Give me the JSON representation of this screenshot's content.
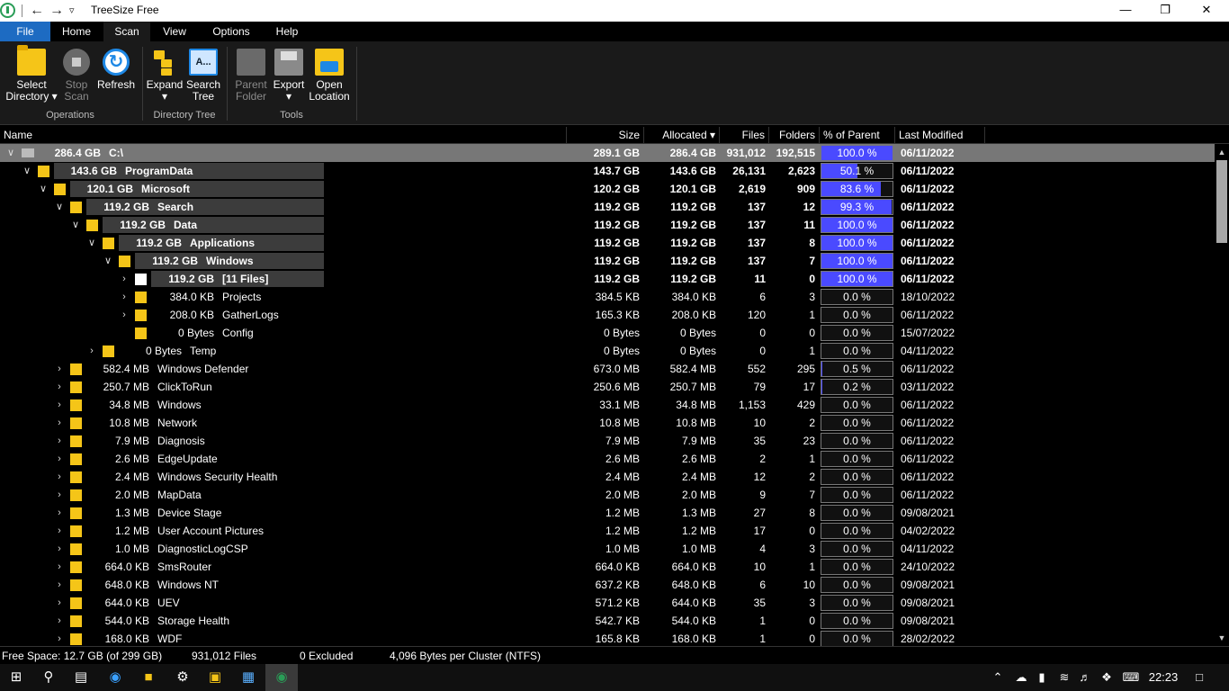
{
  "window": {
    "title": "TreeSize Free",
    "back_glyph": "←",
    "forward_glyph": "→",
    "down_glyph": "▿",
    "minimize": "—",
    "maximize": "❐",
    "close": "✕"
  },
  "menu": {
    "file": "File",
    "home": "Home",
    "scan": "Scan",
    "view": "View",
    "options": "Options",
    "help": "Help"
  },
  "ribbon": {
    "select_directory_1": "Select",
    "select_directory_2": "Directory ▾",
    "stop_scan_1": "Stop",
    "stop_scan_2": "Scan",
    "refresh": "Refresh",
    "expand_1": "Expand",
    "expand_2": "▾",
    "search_tree_1": "Search",
    "search_tree_2": "Tree",
    "search_icon_text": "A...",
    "parent_folder_1": "Parent",
    "parent_folder_2": "Folder",
    "export_1": "Export",
    "export_2": "▾",
    "open_location_1": "Open",
    "open_location_2": "Location",
    "group_operations": "Operations",
    "group_directory_tree": "Directory Tree",
    "group_tools": "Tools"
  },
  "columns": {
    "name": "Name",
    "size": "Size",
    "allocated": "Allocated ▾",
    "files": "Files",
    "folders": "Folders",
    "percent": "% of Parent ...",
    "modified": "Last Modified"
  },
  "rows": [
    {
      "indent": 0,
      "expanded": true,
      "icon": "drive",
      "alloc_label": "286.4 GB",
      "name": "C:\\",
      "size": "289.1 GB",
      "allocated": "286.4 GB",
      "files": "931,012",
      "folders": "192,515",
      "pct": "100.0 %",
      "pct_value": 100.0,
      "modified": "06/11/2022",
      "bold": true,
      "selected": true
    },
    {
      "indent": 1,
      "expanded": true,
      "icon": "folder",
      "alloc_label": "143.6 GB",
      "name": "ProgramData",
      "size": "143.7 GB",
      "allocated": "143.6 GB",
      "files": "26,131",
      "folders": "2,623",
      "pct": "50.1 %",
      "pct_value": 50.1,
      "modified": "06/11/2022",
      "bold": true
    },
    {
      "indent": 2,
      "expanded": true,
      "icon": "folder",
      "alloc_label": "120.1 GB",
      "name": "Microsoft",
      "size": "120.2 GB",
      "allocated": "120.1 GB",
      "files": "2,619",
      "folders": "909",
      "pct": "83.6 %",
      "pct_value": 83.6,
      "modified": "06/11/2022",
      "bold": true
    },
    {
      "indent": 3,
      "expanded": true,
      "icon": "folder",
      "alloc_label": "119.2 GB",
      "name": "Search",
      "size": "119.2 GB",
      "allocated": "119.2 GB",
      "files": "137",
      "folders": "12",
      "pct": "99.3 %",
      "pct_value": 99.3,
      "modified": "06/11/2022",
      "bold": true
    },
    {
      "indent": 4,
      "expanded": true,
      "icon": "folder",
      "alloc_label": "119.2 GB",
      "name": "Data",
      "size": "119.2 GB",
      "allocated": "119.2 GB",
      "files": "137",
      "folders": "11",
      "pct": "100.0 %",
      "pct_value": 100.0,
      "modified": "06/11/2022",
      "bold": true
    },
    {
      "indent": 5,
      "expanded": true,
      "icon": "folder",
      "alloc_label": "119.2 GB",
      "name": "Applications",
      "size": "119.2 GB",
      "allocated": "119.2 GB",
      "files": "137",
      "folders": "8",
      "pct": "100.0 %",
      "pct_value": 100.0,
      "modified": "06/11/2022",
      "bold": true
    },
    {
      "indent": 6,
      "expanded": true,
      "icon": "folder",
      "alloc_label": "119.2 GB",
      "name": "Windows",
      "size": "119.2 GB",
      "allocated": "119.2 GB",
      "files": "137",
      "folders": "7",
      "pct": "100.0 %",
      "pct_value": 100.0,
      "modified": "06/11/2022",
      "bold": true
    },
    {
      "indent": 7,
      "expanded": false,
      "icon": "file",
      "alloc_label": "119.2 GB",
      "name": "[11 Files]",
      "size": "119.2 GB",
      "allocated": "119.2 GB",
      "files": "11",
      "folders": "0",
      "pct": "100.0 %",
      "pct_value": 100.0,
      "modified": "06/11/2022",
      "bold": true,
      "no_chevron": false
    },
    {
      "indent": 7,
      "expanded": false,
      "icon": "folder",
      "alloc_label": "384.0 KB",
      "name": "Projects",
      "size": "384.5 KB",
      "allocated": "384.0 KB",
      "files": "6",
      "folders": "3",
      "pct": "0.0 %",
      "pct_value": 0.0,
      "modified": "18/10/2022"
    },
    {
      "indent": 7,
      "expanded": false,
      "icon": "folder",
      "alloc_label": "208.0 KB",
      "name": "GatherLogs",
      "size": "165.3 KB",
      "allocated": "208.0 KB",
      "files": "120",
      "folders": "1",
      "pct": "0.0 %",
      "pct_value": 0.0,
      "modified": "06/11/2022"
    },
    {
      "indent": 7,
      "expanded": false,
      "icon": "folder",
      "alloc_label": "0 Bytes",
      "name": "Config",
      "size": "0 Bytes",
      "allocated": "0 Bytes",
      "files": "0",
      "folders": "0",
      "pct": "0.0 %",
      "pct_value": 0.0,
      "modified": "15/07/2022",
      "no_chevron": true
    },
    {
      "indent": 5,
      "expanded": false,
      "icon": "folder",
      "alloc_label": "0 Bytes",
      "name": "Temp",
      "size": "0 Bytes",
      "allocated": "0 Bytes",
      "files": "0",
      "folders": "1",
      "pct": "0.0 %",
      "pct_value": 0.0,
      "modified": "04/11/2022"
    },
    {
      "indent": 3,
      "expanded": false,
      "icon": "folder",
      "alloc_label": "582.4 MB",
      "name": "Windows Defender",
      "size": "673.0 MB",
      "allocated": "582.4 MB",
      "files": "552",
      "folders": "295",
      "pct": "0.5 %",
      "pct_value": 0.5,
      "modified": "06/11/2022"
    },
    {
      "indent": 3,
      "expanded": false,
      "icon": "folder",
      "alloc_label": "250.7 MB",
      "name": "ClickToRun",
      "size": "250.6 MB",
      "allocated": "250.7 MB",
      "files": "79",
      "folders": "17",
      "pct": "0.2 %",
      "pct_value": 0.2,
      "modified": "03/11/2022"
    },
    {
      "indent": 3,
      "expanded": false,
      "icon": "folder",
      "alloc_label": "34.8 MB",
      "name": "Windows",
      "size": "33.1 MB",
      "allocated": "34.8 MB",
      "files": "1,153",
      "folders": "429",
      "pct": "0.0 %",
      "pct_value": 0.0,
      "modified": "06/11/2022"
    },
    {
      "indent": 3,
      "expanded": false,
      "icon": "folder",
      "alloc_label": "10.8 MB",
      "name": "Network",
      "size": "10.8 MB",
      "allocated": "10.8 MB",
      "files": "10",
      "folders": "2",
      "pct": "0.0 %",
      "pct_value": 0.0,
      "modified": "06/11/2022"
    },
    {
      "indent": 3,
      "expanded": false,
      "icon": "folder",
      "alloc_label": "7.9 MB",
      "name": "Diagnosis",
      "size": "7.9 MB",
      "allocated": "7.9 MB",
      "files": "35",
      "folders": "23",
      "pct": "0.0 %",
      "pct_value": 0.0,
      "modified": "06/11/2022"
    },
    {
      "indent": 3,
      "expanded": false,
      "icon": "folder",
      "alloc_label": "2.6 MB",
      "name": "EdgeUpdate",
      "size": "2.6 MB",
      "allocated": "2.6 MB",
      "files": "2",
      "folders": "1",
      "pct": "0.0 %",
      "pct_value": 0.0,
      "modified": "06/11/2022"
    },
    {
      "indent": 3,
      "expanded": false,
      "icon": "folder",
      "alloc_label": "2.4 MB",
      "name": "Windows Security Health",
      "size": "2.4 MB",
      "allocated": "2.4 MB",
      "files": "12",
      "folders": "2",
      "pct": "0.0 %",
      "pct_value": 0.0,
      "modified": "06/11/2022"
    },
    {
      "indent": 3,
      "expanded": false,
      "icon": "folder",
      "alloc_label": "2.0 MB",
      "name": "MapData",
      "size": "2.0 MB",
      "allocated": "2.0 MB",
      "files": "9",
      "folders": "7",
      "pct": "0.0 %",
      "pct_value": 0.0,
      "modified": "06/11/2022"
    },
    {
      "indent": 3,
      "expanded": false,
      "icon": "folder",
      "alloc_label": "1.3 MB",
      "name": "Device Stage",
      "size": "1.2 MB",
      "allocated": "1.3 MB",
      "files": "27",
      "folders": "8",
      "pct": "0.0 %",
      "pct_value": 0.0,
      "modified": "09/08/2021"
    },
    {
      "indent": 3,
      "expanded": false,
      "icon": "folder",
      "alloc_label": "1.2 MB",
      "name": "User Account Pictures",
      "size": "1.2 MB",
      "allocated": "1.2 MB",
      "files": "17",
      "folders": "0",
      "pct": "0.0 %",
      "pct_value": 0.0,
      "modified": "04/02/2022"
    },
    {
      "indent": 3,
      "expanded": false,
      "icon": "folder",
      "alloc_label": "1.0 MB",
      "name": "DiagnosticLogCSP",
      "size": "1.0 MB",
      "allocated": "1.0 MB",
      "files": "4",
      "folders": "3",
      "pct": "0.0 %",
      "pct_value": 0.0,
      "modified": "04/11/2022"
    },
    {
      "indent": 3,
      "expanded": false,
      "icon": "folder",
      "alloc_label": "664.0 KB",
      "name": "SmsRouter",
      "size": "664.0 KB",
      "allocated": "664.0 KB",
      "files": "10",
      "folders": "1",
      "pct": "0.0 %",
      "pct_value": 0.0,
      "modified": "24/10/2022"
    },
    {
      "indent": 3,
      "expanded": false,
      "icon": "folder",
      "alloc_label": "648.0 KB",
      "name": "Windows NT",
      "size": "637.2 KB",
      "allocated": "648.0 KB",
      "files": "6",
      "folders": "10",
      "pct": "0.0 %",
      "pct_value": 0.0,
      "modified": "09/08/2021"
    },
    {
      "indent": 3,
      "expanded": false,
      "icon": "folder",
      "alloc_label": "644.0 KB",
      "name": "UEV",
      "size": "571.2 KB",
      "allocated": "644.0 KB",
      "files": "35",
      "folders": "3",
      "pct": "0.0 %",
      "pct_value": 0.0,
      "modified": "09/08/2021"
    },
    {
      "indent": 3,
      "expanded": false,
      "icon": "folder",
      "alloc_label": "544.0 KB",
      "name": "Storage Health",
      "size": "542.7 KB",
      "allocated": "544.0 KB",
      "files": "1",
      "folders": "0",
      "pct": "0.0 %",
      "pct_value": 0.0,
      "modified": "09/08/2021"
    },
    {
      "indent": 3,
      "expanded": false,
      "icon": "folder",
      "alloc_label": "168.0 KB",
      "name": "WDF",
      "size": "165.8 KB",
      "allocated": "168.0 KB",
      "files": "1",
      "folders": "0",
      "pct": "0.0 %",
      "pct_value": 0.0,
      "modified": "28/02/2022"
    }
  ],
  "status": {
    "free_space": "Free Space: 12.7 GB  (of 299 GB)",
    "files": "931,012 Files",
    "excluded": "0 Excluded",
    "cluster": "4,096 Bytes per Cluster (NTFS)"
  },
  "taskbar": {
    "clock": "22:23"
  },
  "colors": {
    "accent": "#1d6bc2",
    "pct_fill": "#4a4aff",
    "folder": "#f5c518"
  }
}
